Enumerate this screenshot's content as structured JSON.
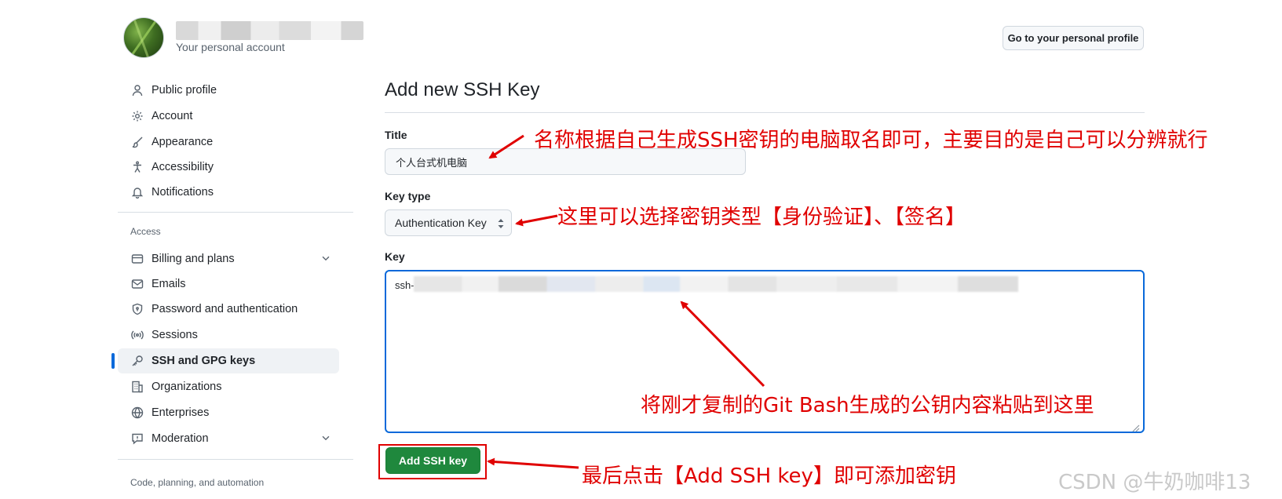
{
  "account": {
    "subtitle": "Your personal account",
    "profile_button": "Go to your personal profile"
  },
  "sidebar": {
    "items": [
      {
        "label": "Public profile",
        "icon": "person-icon"
      },
      {
        "label": "Account",
        "icon": "gear-icon"
      },
      {
        "label": "Appearance",
        "icon": "paintbrush-icon"
      },
      {
        "label": "Accessibility",
        "icon": "accessibility-icon"
      },
      {
        "label": "Notifications",
        "icon": "bell-icon"
      }
    ],
    "access_label": "Access",
    "access_items": [
      {
        "label": "Billing and plans",
        "icon": "credit-card-icon"
      },
      {
        "label": "Emails",
        "icon": "mail-icon"
      },
      {
        "label": "Password and authentication",
        "icon": "shield-icon"
      },
      {
        "label": "Sessions",
        "icon": "broadcast-icon"
      },
      {
        "label": "SSH and GPG keys",
        "icon": "key-icon",
        "active": true
      },
      {
        "label": "Organizations",
        "icon": "organization-icon"
      },
      {
        "label": "Enterprises",
        "icon": "globe-icon"
      },
      {
        "label": "Moderation",
        "icon": "report-icon"
      }
    ],
    "code_label": "Code, planning, and automation"
  },
  "form": {
    "heading": "Add new SSH Key",
    "title_label": "Title",
    "title_value": "个人台式机电脑",
    "key_type_label": "Key type",
    "key_type_value": "Authentication Key",
    "key_label": "Key",
    "key_value_prefix": "ssh-",
    "submit_label": "Add SSH key"
  },
  "annotations": {
    "title_note": "名称根据自己生成SSH密钥的电脑取名即可，主要目的是自己可以分辨就行",
    "key_type_note": "这里可以选择密钥类型【身份验证】、【签名】",
    "key_note": "将刚才复制的Git Bash生成的公钥内容粘贴到这里",
    "button_note": "最后点击【Add SSH key】即可添加密钥",
    "color": "#e00000"
  },
  "watermark": "CSDN @牛奶咖啡13",
  "colors": {
    "primary_button": "#1f883d",
    "focus_border": "#0969da",
    "active_indicator": "#0969da"
  }
}
